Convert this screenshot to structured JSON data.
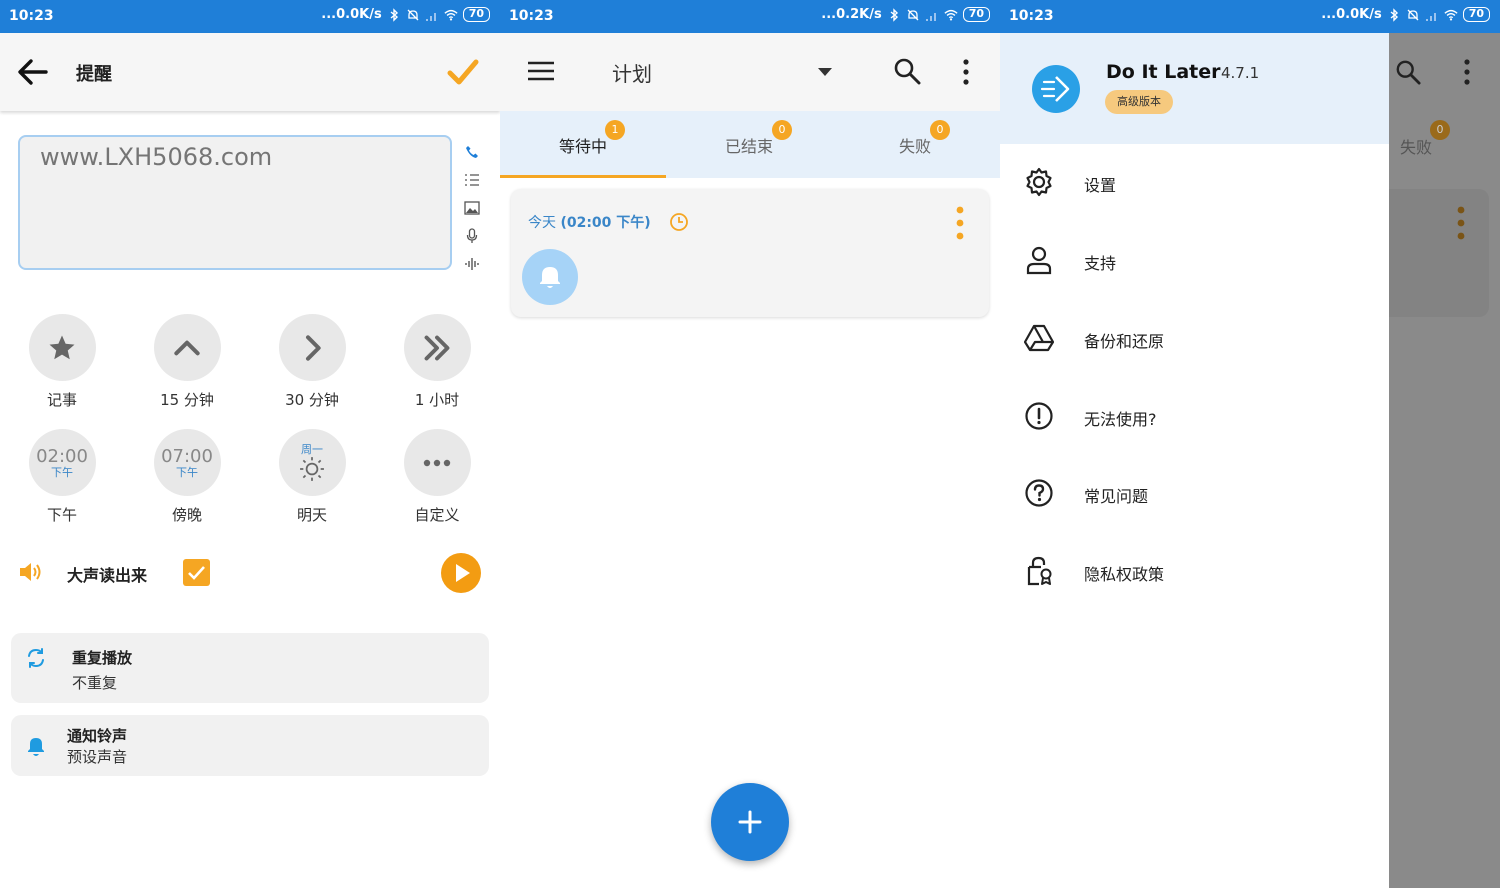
{
  "status": {
    "time": "10:23",
    "speed_1": "...0.0K/s",
    "speed_2": "...0.2K/s",
    "speed_3": "...0.0K/s",
    "battery": "70"
  },
  "reminder": {
    "title": "提醒",
    "placeholder": "www.LXH5068.com",
    "quick": [
      {
        "label": "记事"
      },
      {
        "label": "15 分钟"
      },
      {
        "label": "30 分钟"
      },
      {
        "label": "1 小时"
      },
      {
        "time": "02:00",
        "sub": "下午",
        "label": "下午"
      },
      {
        "time": "07:00",
        "sub": "下午",
        "label": "傍晚"
      },
      {
        "top": "周一",
        "label": "明天"
      },
      {
        "label": "自定义"
      }
    ],
    "read_aloud": "大声读出来",
    "repeat": {
      "title": "重复播放",
      "value": "不重复"
    },
    "ringtone": {
      "title": "通知铃声",
      "value": "预设声音"
    }
  },
  "plan": {
    "title": "计划",
    "tabs": [
      {
        "label": "等待中",
        "badge": "1"
      },
      {
        "label": "已结束",
        "badge": "0"
      },
      {
        "label": "失败",
        "badge": "0"
      }
    ],
    "task": {
      "day": "今天",
      "time": "(02:00 下午)"
    }
  },
  "drawer": {
    "app_name": "Do It Later",
    "version": "4.7.1",
    "premium": "高级版本",
    "items": [
      {
        "label": "设置"
      },
      {
        "label": "支持"
      },
      {
        "label": "备份和还原"
      },
      {
        "label": "无法使用?"
      },
      {
        "label": "常见问题"
      },
      {
        "label": "隐私权政策"
      }
    ],
    "behind_tab": "失败",
    "behind_badge": "0"
  },
  "colors": {
    "status_bar": "#1f7fd8",
    "accent_orange": "#f5a623",
    "link_blue": "#3a86c8",
    "tab_bg": "#e6f0fa"
  }
}
